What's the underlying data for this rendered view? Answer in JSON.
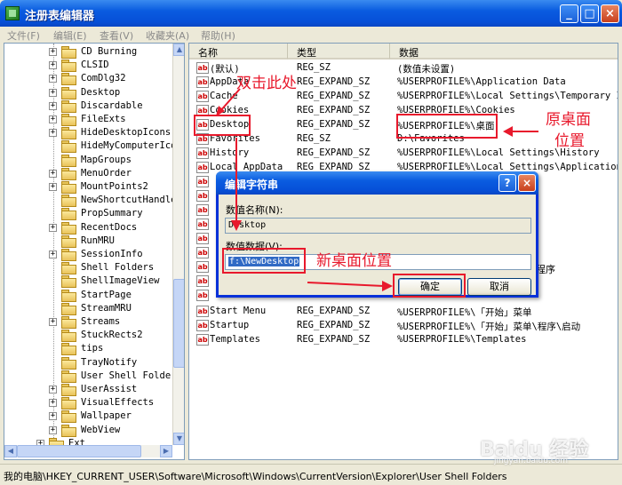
{
  "window": {
    "title": "注册表编辑器",
    "min": "_",
    "max": "□",
    "close": "×"
  },
  "menu": [
    {
      "label": "文件(F)"
    },
    {
      "label": "编辑(E)"
    },
    {
      "label": "查看(V)"
    },
    {
      "label": "收藏夹(A)"
    },
    {
      "label": "帮助(H)"
    }
  ],
  "tree": {
    "items": [
      {
        "label": "CD Burning",
        "expander": "+"
      },
      {
        "label": "CLSID",
        "expander": "+"
      },
      {
        "label": "ComDlg32",
        "expander": "+"
      },
      {
        "label": "Desktop",
        "expander": "+"
      },
      {
        "label": "Discardable",
        "expander": "+"
      },
      {
        "label": "FileExts",
        "expander": "+"
      },
      {
        "label": "HideDesktopIcons",
        "expander": "+"
      },
      {
        "label": "HideMyComputerIcon",
        "expander": ""
      },
      {
        "label": "MapGroups",
        "expander": ""
      },
      {
        "label": "MenuOrder",
        "expander": "+"
      },
      {
        "label": "MountPoints2",
        "expander": "+"
      },
      {
        "label": "NewShortcutHandlers",
        "expander": ""
      },
      {
        "label": "PropSummary",
        "expander": ""
      },
      {
        "label": "RecentDocs",
        "expander": "+"
      },
      {
        "label": "RunMRU",
        "expander": ""
      },
      {
        "label": "SessionInfo",
        "expander": "+"
      },
      {
        "label": "Shell Folders",
        "expander": ""
      },
      {
        "label": "ShellImageView",
        "expander": ""
      },
      {
        "label": "StartPage",
        "expander": ""
      },
      {
        "label": "StreamMRU",
        "expander": ""
      },
      {
        "label": "Streams",
        "expander": "+"
      },
      {
        "label": "StuckRects2",
        "expander": ""
      },
      {
        "label": "tips",
        "expander": ""
      },
      {
        "label": "TrayNotify",
        "expander": ""
      },
      {
        "label": "User Shell Folders",
        "expander": ""
      },
      {
        "label": "UserAssist",
        "expander": "+"
      },
      {
        "label": "VisualEffects",
        "expander": "+"
      },
      {
        "label": "Wallpaper",
        "expander": "+"
      },
      {
        "label": "WebView",
        "expander": "+"
      },
      {
        "label": "Ext",
        "expander": "+"
      }
    ]
  },
  "columns": {
    "name": "名称",
    "type": "类型",
    "data": "数据"
  },
  "values": [
    {
      "name": "(默认)",
      "type": "REG_SZ",
      "data": "(数值未设置)"
    },
    {
      "name": "AppData",
      "type": "REG_EXPAND_SZ",
      "data": "%USERPROFILE%\\Application Data"
    },
    {
      "name": "Cache",
      "type": "REG_EXPAND_SZ",
      "data": "%USERPROFILE%\\Local Settings\\Temporary Inte"
    },
    {
      "name": "Cookies",
      "type": "REG_EXPAND_SZ",
      "data": "%USERPROFILE%\\Cookies"
    },
    {
      "name": "Desktop",
      "type": "REG_EXPAND_SZ",
      "data": "%USERPROFILE%\\桌面"
    },
    {
      "name": "Favorites",
      "type": "REG_SZ",
      "data": "D:\\Favorites"
    },
    {
      "name": "History",
      "type": "REG_EXPAND_SZ",
      "data": "%USERPROFILE%\\Local Settings\\History"
    },
    {
      "name": "Local AppData",
      "type": "REG_EXPAND_SZ",
      "data": "%USERPROFILE%\\Local Settings\\Application Da"
    },
    {
      "name": "Start Menu",
      "type": "REG_EXPAND_SZ",
      "data": "%USERPROFILE%\\「开始」菜单"
    },
    {
      "name": "Startup",
      "type": "REG_EXPAND_SZ",
      "data": "%USERPROFILE%\\「开始」菜单\\程序\\启动"
    },
    {
      "name": "Templates",
      "type": "REG_EXPAND_SZ",
      "data": "%USERPROFILE%\\Templates"
    }
  ],
  "hidden_row_fragment": "程序",
  "dialog": {
    "title": "编辑字符串",
    "help": "?",
    "close": "×",
    "name_label": "数值名称(N):",
    "name_value": "Desktop",
    "data_label": "数值数据(V):",
    "data_value": "f:\\NewDesktop",
    "ok": "确定",
    "cancel": "取消"
  },
  "status": {
    "path": "我的电脑\\HKEY_CURRENT_USER\\Software\\Microsoft\\Windows\\CurrentVersion\\Explorer\\User Shell Folders"
  },
  "annotations": {
    "double_click": "双击此处",
    "original_line1": "原桌面",
    "original_line2": "位置",
    "new_location": "新桌面位置",
    "color": "#e8192c"
  },
  "watermark": {
    "brand": "Baidu 经验",
    "url": "jingyan.baidu.com"
  }
}
